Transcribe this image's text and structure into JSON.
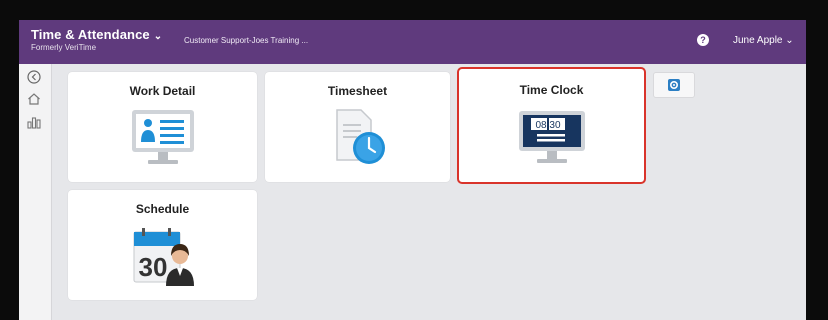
{
  "header": {
    "app_title": "Time & Attendance",
    "app_subtitle": "Formerly VeriTime",
    "company": "Customer Support-Joes Training ...",
    "user_name": "June Apple",
    "help_icon": "help-circle-icon"
  },
  "sidebar": {
    "items": [
      {
        "icon": "back-circle-icon"
      },
      {
        "icon": "home-icon"
      },
      {
        "icon": "reports-chart-icon"
      }
    ]
  },
  "tiles": [
    {
      "label": "Work Detail",
      "icon": "work-detail-monitor-icon"
    },
    {
      "label": "Timesheet",
      "icon": "timesheet-clock-icon"
    },
    {
      "label": "Time Clock",
      "icon": "time-clock-monitor-icon",
      "clock_time": "08 30",
      "selected": true
    },
    {
      "label": "Schedule",
      "icon": "schedule-calendar-icon",
      "date_number": "30"
    }
  ],
  "settings_button": {
    "icon": "gear-icon"
  },
  "colors": {
    "header_bg": "#5f3a7d",
    "content_bg": "#e6e7ea",
    "selection_outline": "#d9342b",
    "icon_blue": "#1f8fd6"
  }
}
